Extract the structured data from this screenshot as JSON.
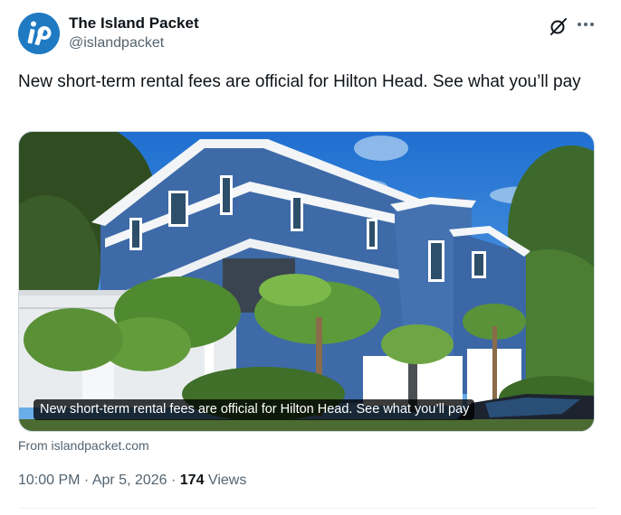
{
  "author": {
    "display_name": "The Island Packet",
    "handle": "@islandpacket",
    "avatar_text": "ip",
    "avatar_color": "#1f7ac2"
  },
  "icons": {
    "grok": "grok-icon",
    "more": "more-options-icon"
  },
  "tweet": {
    "text": "New short-term rental fees are official for Hilton Head. See what you’ll pay"
  },
  "card": {
    "caption": "New short-term rental fees are official for Hilton Head. See what you’ll pay",
    "source": "From islandpacket.com"
  },
  "meta": {
    "time": "10:00 PM",
    "separator_1": " · ",
    "date": "Apr 5, 2026",
    "separator_2": " · ",
    "views_count": "174",
    "views_label": " Views"
  },
  "colors": {
    "text_primary": "#0f1419",
    "text_secondary": "#536471",
    "sky": "#2f7fd6",
    "siding": "#3e6aa8"
  }
}
